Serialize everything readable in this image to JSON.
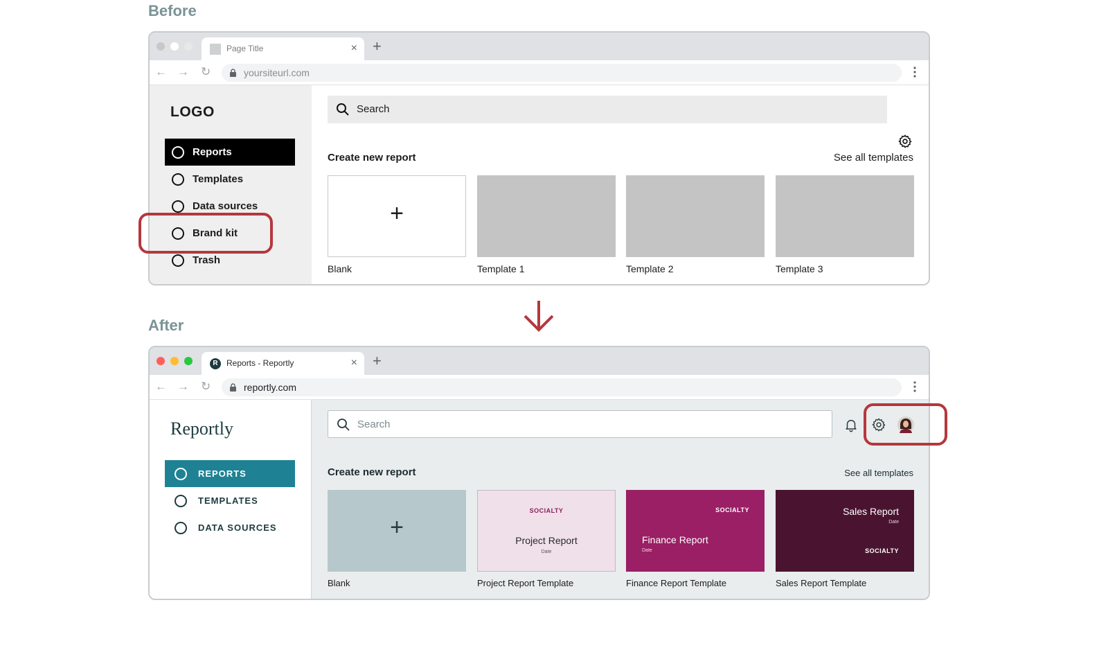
{
  "labels": {
    "before": "Before",
    "after": "After"
  },
  "before": {
    "tab_title": "Page Title",
    "url": "yoursiteurl.com",
    "logo": "LOGO",
    "nav": [
      {
        "label": "Reports",
        "active": true
      },
      {
        "label": "Templates",
        "active": false
      },
      {
        "label": "Data sources",
        "active": false
      },
      {
        "label": "Brand kit",
        "active": false
      },
      {
        "label": "Trash",
        "active": false
      }
    ],
    "search_placeholder": "Search",
    "section_title": "Create new report",
    "see_all": "See all templates",
    "cards": [
      {
        "label": "Blank",
        "plus": "+"
      },
      {
        "label": "Template 1"
      },
      {
        "label": "Template 2"
      },
      {
        "label": "Template 3"
      }
    ]
  },
  "after": {
    "tab_title": "Reports - Reportly",
    "favicon_letter": "R",
    "url": "reportly.com",
    "logo": "Reportly",
    "nav": [
      {
        "label": "REPORTS",
        "active": true
      },
      {
        "label": "TEMPLATES",
        "active": false
      },
      {
        "label": "DATA SOURCES",
        "active": false
      }
    ],
    "search_placeholder": "Search",
    "section_title": "Create new report",
    "see_all": "See all templates",
    "cards": [
      {
        "label": "Blank",
        "plus": "+"
      },
      {
        "label": "Project Report Template",
        "brand": "SOCIALTY",
        "title": "Project Report",
        "date": "Date"
      },
      {
        "label": "Finance Report Template",
        "brand": "SOCIALTY",
        "title": "Finance Report",
        "date": "Date"
      },
      {
        "label": "Sales Report Template",
        "brand": "SOCIALTY",
        "title": "Sales Report",
        "date": "Date"
      }
    ]
  },
  "colors": {
    "highlight": "#b5373d",
    "accent_teal": "#1f8294",
    "project_card": "#efe0ea",
    "finance_card": "#9a1f64",
    "sales_card": "#4a1430",
    "blank_after": "#b7c8cc"
  },
  "icons": [
    "search-icon",
    "gear-icon",
    "bell-icon",
    "avatar",
    "arrow-down-icon",
    "lock-icon",
    "plus-icon"
  ]
}
